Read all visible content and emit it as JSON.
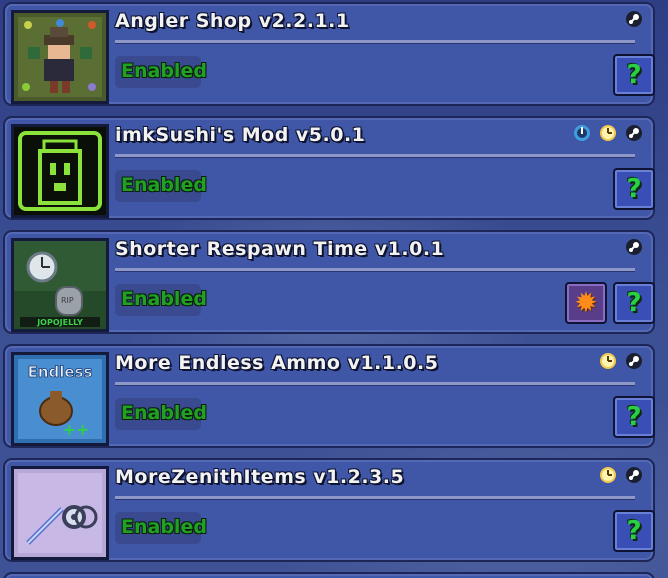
{
  "mods": [
    {
      "name": "Angler Shop v2.2.1.1",
      "status": "Enabled",
      "icons": [
        "steam-icon"
      ],
      "buttons": {
        "help": "?"
      },
      "icon_art": "angler"
    },
    {
      "name": "imkSushi's Mod v5.0.1",
      "status": "Enabled",
      "icons": [
        "translation-icon",
        "clock-icon",
        "steam-icon"
      ],
      "buttons": {
        "help": "?"
      },
      "icon_art": "sushi"
    },
    {
      "name": "Shorter Respawn Time v1.0.1",
      "status": "Enabled",
      "icons": [
        "steam-icon"
      ],
      "buttons": {
        "help": "?",
        "config": "gear-icon"
      },
      "icon_art": "respawn",
      "icon_text": "JOPOJELLY"
    },
    {
      "name": "More Endless Ammo v1.1.0.5",
      "status": "Enabled",
      "icons": [
        "clock-icon",
        "steam-icon"
      ],
      "buttons": {
        "help": "?"
      },
      "icon_art": "ammo",
      "icon_text": "Endless"
    },
    {
      "name": "MoreZenithItems v1.2.3.5",
      "status": "Enabled",
      "icons": [
        "clock-icon",
        "steam-icon"
      ],
      "buttons": {
        "help": "?"
      },
      "icon_art": "zenith"
    }
  ],
  "colors": {
    "panel_bg": "#3f57a6",
    "enabled_text": "#21a024",
    "help_text": "#29cf45",
    "config_gear": "#ff8c1a"
  }
}
